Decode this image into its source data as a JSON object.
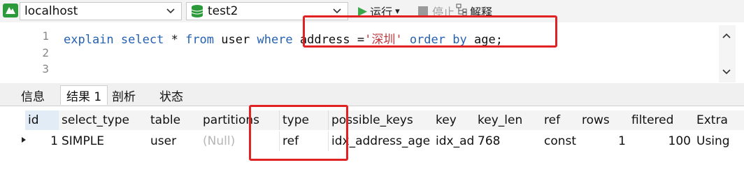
{
  "toolbar": {
    "connection": "localhost",
    "database": "test2",
    "run_label": "运行",
    "run_dropdown": "▾",
    "stop_label": "停止",
    "explain_label": "解释"
  },
  "editor": {
    "line_numbers": [
      "1",
      "2",
      "3"
    ],
    "sql": {
      "kw_explain": "explain",
      "kw_select": "select",
      "star": "*",
      "kw_from": "from",
      "table": "user",
      "kw_where": "where",
      "column": "address",
      "op": "=",
      "string": "'深圳'",
      "kw_order": "order",
      "kw_by": "by",
      "tail": "age;"
    }
  },
  "tabs": [
    "信息",
    "结果 1",
    "剖析",
    "状态"
  ],
  "result": {
    "columns": [
      "id",
      "select_type",
      "table",
      "partitions",
      "type",
      "possible_keys",
      "key",
      "key_len",
      "ref",
      "rows",
      "filtered",
      "Extra"
    ],
    "rows": [
      [
        "1",
        "SIMPLE",
        "user",
        "(Null)",
        "ref",
        "idx_address_age",
        "idx_ad",
        "768",
        "const",
        "1",
        "100",
        "Using"
      ]
    ]
  },
  "colors": {
    "keyword": "#2561b3",
    "string": "#c2383d",
    "highlight_box": "#e02222",
    "null_text": "#b6b6b6"
  }
}
